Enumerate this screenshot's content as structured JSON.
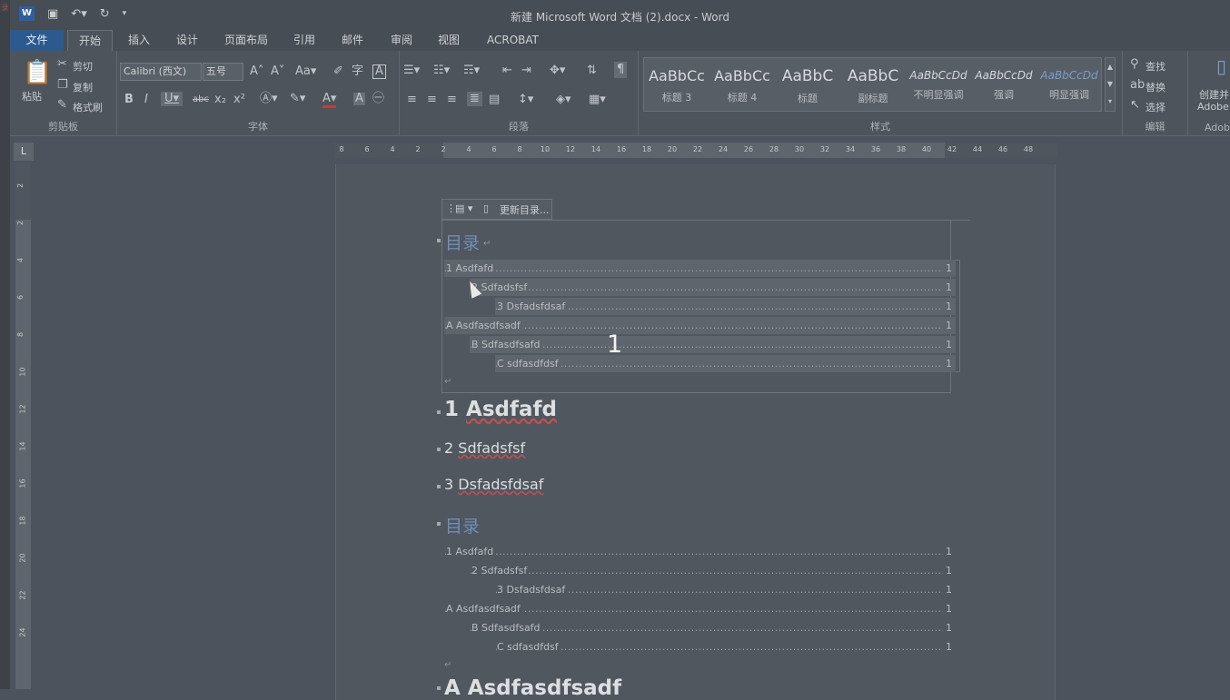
{
  "window": {
    "title": "新建 Microsoft Word 文档 (2).docx - Word"
  },
  "qat": {
    "app_icon": "W"
  },
  "tabs": [
    "文件",
    "开始",
    "插入",
    "设计",
    "页面布局",
    "引用",
    "邮件",
    "审阅",
    "视图",
    "ACROBAT"
  ],
  "clipboard": {
    "paste": "粘贴",
    "cut": "剪切",
    "copy": "复制",
    "painter": "格式刷",
    "label": "剪贴板"
  },
  "font": {
    "name": "Calibri (西文)",
    "size": "五号",
    "label": "字体"
  },
  "paragraph": {
    "label": "段落"
  },
  "styles": {
    "label": "样式",
    "items": [
      {
        "sample": "AaBbCc",
        "name": "标题 3"
      },
      {
        "sample": "AaBbCc",
        "name": "标题 4"
      },
      {
        "sample": "AaBbC",
        "name": "标题"
      },
      {
        "sample": "AaBbC",
        "name": "副标题"
      },
      {
        "sample": "AaBbCcDd",
        "name": "不明显强调"
      },
      {
        "sample": "AaBbCcDd",
        "name": "强调"
      },
      {
        "sample": "AaBbCcDd",
        "name": "明显强调"
      }
    ]
  },
  "editing": {
    "find": "查找",
    "replace": "替换",
    "select": "选择",
    "label": "编辑"
  },
  "adobe": {
    "line1": "创建并",
    "line2": "Adobe",
    "label": "Adob"
  },
  "ruler_h": [
    "8",
    "6",
    "4",
    "2",
    "2",
    "4",
    "6",
    "8",
    "10",
    "12",
    "14",
    "16",
    "18",
    "20",
    "22",
    "24",
    "26",
    "28",
    "30",
    "32",
    "34",
    "36",
    "38",
    "40",
    "42",
    "44",
    "46",
    "48"
  ],
  "ruler_v": [
    "2",
    "2",
    "4",
    "6",
    "8",
    "10",
    "12",
    "14",
    "16",
    "18",
    "20",
    "22",
    "24"
  ],
  "toc_toolbar": {
    "update": "更新目录..."
  },
  "toc1": {
    "heading": "目录",
    "entries": [
      {
        "text": "1 Asdfafd",
        "page": "1"
      },
      {
        "text": "2 Sdfadsfsf",
        "page": "1"
      },
      {
        "text": "3 Dsfadsfdsaf",
        "page": "1"
      },
      {
        "text": "A Asdfasdfsadf",
        "page": "1"
      },
      {
        "text": "B Sdfasdfsafd",
        "page": "1"
      },
      {
        "text": "C sdfasdfdsf",
        "page": "1"
      }
    ]
  },
  "overlay_number": "1",
  "headings": [
    {
      "num": "1",
      "text": "Asdfafd"
    },
    {
      "num": "2",
      "text": "Sdfadsfsf"
    },
    {
      "num": "3",
      "text": "Dsfadsfdsaf"
    }
  ],
  "toc2": {
    "heading": "目录",
    "entries": [
      {
        "text": "1 Asdfafd",
        "page": "1"
      },
      {
        "text": "2 Sdfadsfsf",
        "page": "1"
      },
      {
        "text": "3 Dsfadsfdsaf",
        "page": "1"
      },
      {
        "text": "A Asdfasdfsadf",
        "page": "1"
      },
      {
        "text": "B Sdfasdfsafd",
        "page": "1"
      },
      {
        "text": "C sdfasdfdsf",
        "page": "1"
      }
    ]
  },
  "bottom_heading": {
    "text": "A Asdfasdfsadf"
  },
  "para_mark": "↵"
}
